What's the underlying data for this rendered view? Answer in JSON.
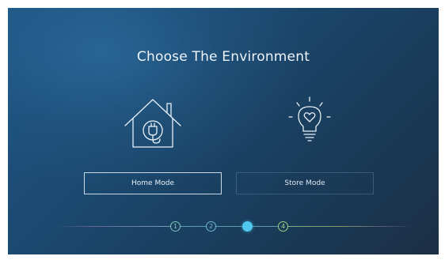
{
  "screen": {
    "title": "Choose The Environment"
  },
  "options": {
    "home": {
      "icon": "house-plug-icon",
      "label": "Home Mode",
      "selected": true
    },
    "store": {
      "icon": "lightbulb-heart-icon",
      "label": "Store Mode",
      "selected": false
    }
  },
  "stepper": {
    "steps": [
      "1",
      "2",
      "3",
      "4"
    ],
    "current_step": 3,
    "colors": {
      "step_1": "#7ec8c2",
      "step_2": "#72b8d6",
      "step_3": "#4fc8ef",
      "step_4": "#9fd18a"
    }
  },
  "theme": {
    "background_start": "#1e5585",
    "background_end": "#1b2f45",
    "text": "#eef4fa"
  }
}
